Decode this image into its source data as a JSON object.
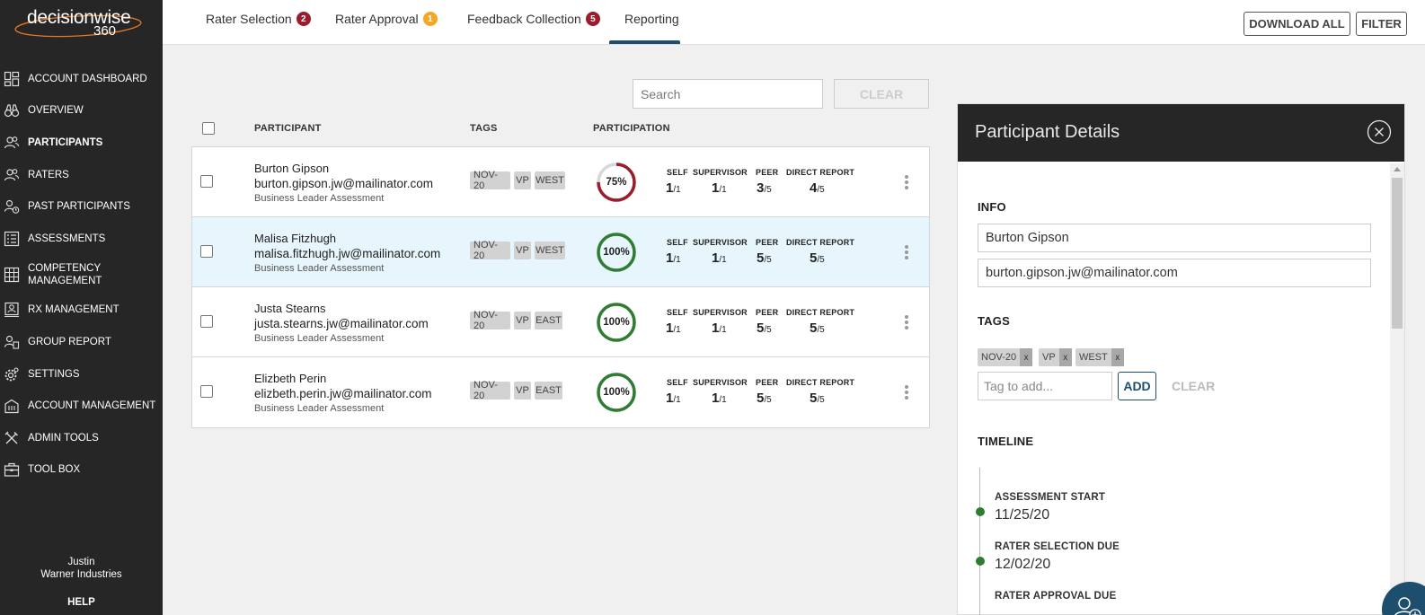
{
  "brand": {
    "word": "decisionwise",
    "num": "360"
  },
  "sidebar": {
    "items": [
      {
        "label": "ACCOUNT DASHBOARD",
        "icon": "dashboard-icon"
      },
      {
        "label": "OVERVIEW",
        "icon": "binoculars-icon"
      },
      {
        "label": "PARTICIPANTS",
        "icon": "users-icon",
        "active": true
      },
      {
        "label": "RATERS",
        "icon": "users-icon"
      },
      {
        "label": "PAST PARTICIPANTS",
        "icon": "users-history-icon"
      },
      {
        "label": "ASSESSMENTS",
        "icon": "list-icon"
      },
      {
        "label": "COMPETENCY MANAGEMENT",
        "icon": "grid-icon"
      },
      {
        "label": "RX MANAGEMENT",
        "icon": "person-board-icon"
      },
      {
        "label": "GROUP REPORT",
        "icon": "group-report-icon"
      },
      {
        "label": "SETTINGS",
        "icon": "gear-icon"
      },
      {
        "label": "ACCOUNT MANAGEMENT",
        "icon": "building-icon"
      },
      {
        "label": "ADMIN TOOLS",
        "icon": "tools-icon"
      },
      {
        "label": "TOOL BOX",
        "icon": "toolbox-icon"
      }
    ],
    "user_name": "Justin",
    "company": "Warner Industries",
    "help": "HELP"
  },
  "tabs": [
    {
      "label": "Rater Selection",
      "badge": "2",
      "badge_color": "#9b1c2c"
    },
    {
      "label": "Rater Approval",
      "badge": "1",
      "badge_color": "#f5a623"
    },
    {
      "label": "Feedback Collection",
      "badge": "5",
      "badge_color": "#9b1c2c"
    },
    {
      "label": "Reporting",
      "badge": ""
    }
  ],
  "toolbar": {
    "download_all": "DOWNLOAD ALL",
    "filter": "FILTER"
  },
  "search": {
    "placeholder": "Search",
    "clear": "CLEAR"
  },
  "table": {
    "headers": {
      "participant": "PARTICIPANT",
      "tags": "TAGS",
      "participation": "PARTICIPATION"
    },
    "stat_labels": [
      "SELF",
      "SUPERVISOR",
      "PEER",
      "DIRECT REPORT"
    ],
    "rows": [
      {
        "name": "Burton Gipson",
        "email": "burton.gipson.jw@mailinator.com",
        "assessment": "Business Leader Assessment",
        "tags": [
          "NOV-20",
          "VP",
          "WEST"
        ],
        "percent_label": "75%",
        "percent": 75,
        "ring_color": "#9b1c2c",
        "stats": [
          {
            "v": "1",
            "t": "/1"
          },
          {
            "v": "1",
            "t": "/1"
          },
          {
            "v": "3",
            "t": "/5"
          },
          {
            "v": "4",
            "t": "/5"
          }
        ]
      },
      {
        "name": "Malisa Fitzhugh",
        "email": "malisa.fitzhugh.jw@mailinator.com",
        "assessment": "Business Leader Assessment",
        "tags": [
          "NOV-20",
          "VP",
          "WEST"
        ],
        "percent_label": "100%",
        "percent": 100,
        "ring_color": "#2e7d32",
        "highlight": true,
        "stats": [
          {
            "v": "1",
            "t": "/1"
          },
          {
            "v": "1",
            "t": "/1"
          },
          {
            "v": "5",
            "t": "/5"
          },
          {
            "v": "5",
            "t": "/5"
          }
        ]
      },
      {
        "name": "Justa Stearns",
        "email": "justa.stearns.jw@mailinator.com",
        "assessment": "Business Leader Assessment",
        "tags": [
          "NOV-20",
          "VP",
          "EAST"
        ],
        "percent_label": "100%",
        "percent": 100,
        "ring_color": "#2e7d32",
        "stats": [
          {
            "v": "1",
            "t": "/1"
          },
          {
            "v": "1",
            "t": "/1"
          },
          {
            "v": "5",
            "t": "/5"
          },
          {
            "v": "5",
            "t": "/5"
          }
        ]
      },
      {
        "name": "Elizbeth Perin",
        "email": "elizbeth.perin.jw@mailinator.com",
        "assessment": "Business Leader Assessment",
        "tags": [
          "NOV-20",
          "VP",
          "EAST"
        ],
        "percent_label": "100%",
        "percent": 100,
        "ring_color": "#2e7d32",
        "stats": [
          {
            "v": "1",
            "t": "/1"
          },
          {
            "v": "1",
            "t": "/1"
          },
          {
            "v": "5",
            "t": "/5"
          },
          {
            "v": "5",
            "t": "/5"
          }
        ]
      }
    ]
  },
  "details": {
    "title": "Participant Details",
    "info_heading": "INFO",
    "name": "Burton Gipson",
    "email": "burton.gipson.jw@mailinator.com",
    "tags_heading": "TAGS",
    "tags": [
      "NOV-20",
      "VP",
      "WEST"
    ],
    "tag_placeholder": "Tag to add...",
    "add": "ADD",
    "clear": "CLEAR",
    "timeline_heading": "TIMELINE",
    "timeline": [
      {
        "label": "ASSESSMENT START",
        "date": "11/25/20"
      },
      {
        "label": "RATER SELECTION DUE",
        "date": "12/02/20"
      },
      {
        "label": "RATER APPROVAL DUE",
        "date": ""
      }
    ]
  },
  "colors": {
    "sidebar_bg": "#262626",
    "accent": "#1d4e6e",
    "complete": "#2e7d32",
    "incomplete": "#9b1c2c",
    "highlight_row": "#e6f6fc"
  }
}
